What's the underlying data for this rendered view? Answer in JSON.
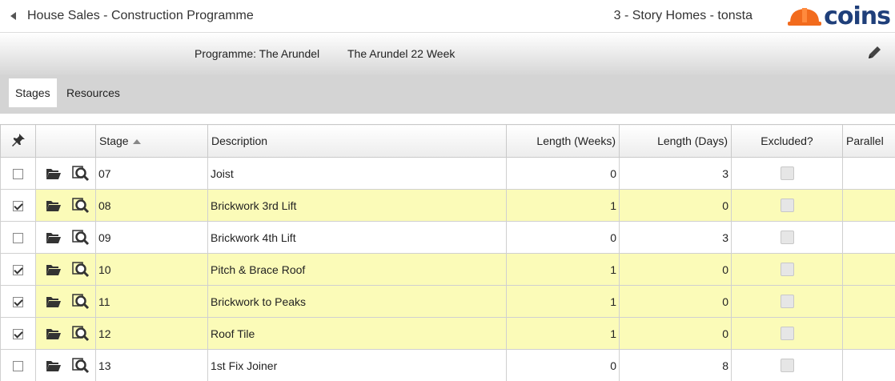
{
  "header": {
    "back_icon": "caret-left-icon",
    "title": "House Sales - Construction Programme",
    "company": "3 - Story Homes - tonsta",
    "logo_text": "coins"
  },
  "programme": {
    "label": "Programme: The Arundel",
    "value": "The Arundel 22 Week",
    "edit_icon": "pencil-icon"
  },
  "tabs": [
    {
      "label": "Stages",
      "active": true
    },
    {
      "label": "Resources",
      "active": false
    }
  ],
  "table": {
    "columns": [
      "",
      "",
      "Stage",
      "Description",
      "Length (Weeks)",
      "Length (Days)",
      "Excluded?",
      "Parallel"
    ],
    "pin_icon": "pin-icon",
    "rows": [
      {
        "checked": false,
        "stage": "07",
        "description": "Joist",
        "weeks": "0",
        "days": "3",
        "parallel": ""
      },
      {
        "checked": true,
        "stage": "08",
        "description": "Brickwork 3rd Lift",
        "weeks": "1",
        "days": "0",
        "parallel": ""
      },
      {
        "checked": false,
        "stage": "09",
        "description": "Brickwork 4th Lift",
        "weeks": "0",
        "days": "3",
        "parallel": ""
      },
      {
        "checked": true,
        "stage": "10",
        "description": "Pitch & Brace Roof",
        "weeks": "1",
        "days": "0",
        "parallel": ""
      },
      {
        "checked": true,
        "stage": "11",
        "description": "Brickwork to Peaks",
        "weeks": "1",
        "days": "0",
        "parallel": ""
      },
      {
        "checked": true,
        "stage": "12",
        "description": "Roof Tile",
        "weeks": "1",
        "days": "0",
        "parallel": ""
      },
      {
        "checked": false,
        "stage": "13",
        "description": "1st Fix Joiner",
        "weeks": "0",
        "days": "8",
        "parallel": ""
      }
    ]
  },
  "colors": {
    "highlight_row": "#fbfbb8",
    "logo_orange": "#f26b1d",
    "logo_blue": "#1f3f7a"
  }
}
